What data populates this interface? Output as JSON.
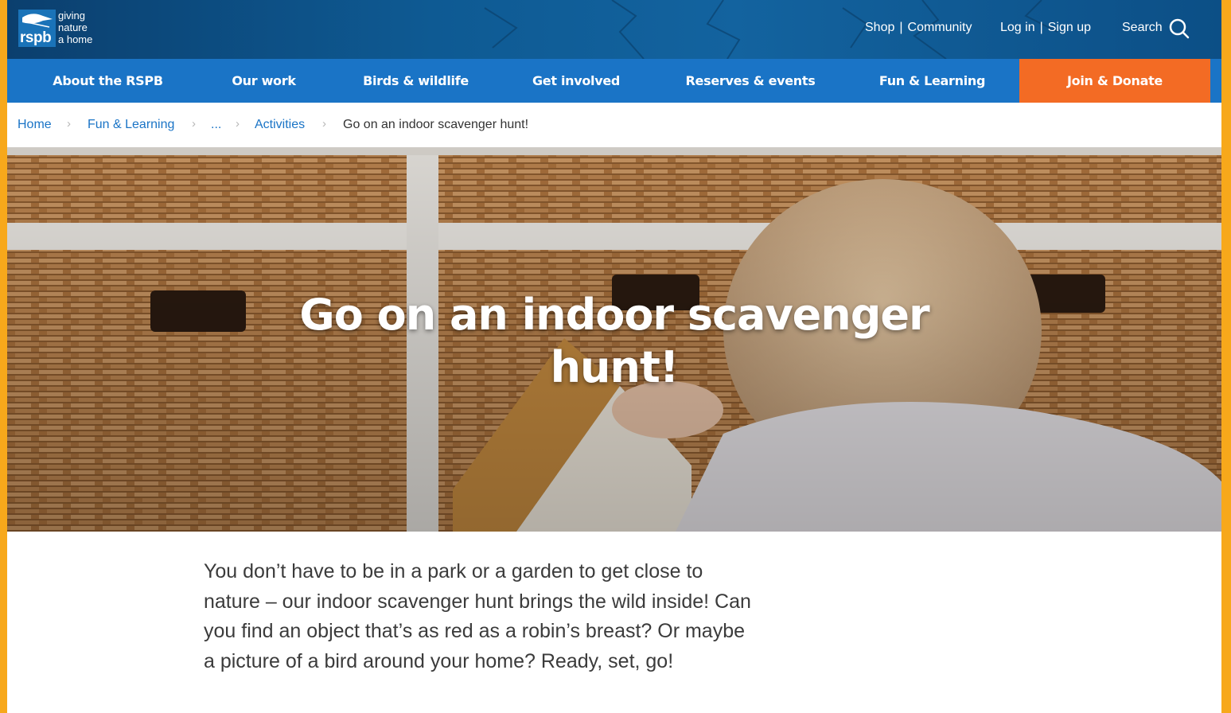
{
  "header": {
    "logo": {
      "brand": "rspb",
      "tagline": [
        "giving",
        "nature",
        "a home"
      ]
    },
    "utility": {
      "shop": "Shop",
      "community": "Community",
      "login": "Log in",
      "signup": "Sign up",
      "separator": "|",
      "search": "Search"
    }
  },
  "nav": {
    "items": [
      {
        "label": "About the RSPB"
      },
      {
        "label": "Our work"
      },
      {
        "label": "Birds & wildlife"
      },
      {
        "label": "Get involved"
      },
      {
        "label": "Reserves & events"
      },
      {
        "label": "Fun & Learning"
      }
    ],
    "donate": "Join & Donate",
    "colors": {
      "nav": "#1a74c6",
      "donate": "#f36b24",
      "link": "#1a74c6"
    }
  },
  "breadcrumb": {
    "items": [
      "Home",
      "Fun & Learning",
      "...",
      "Activities",
      "Go on an indoor scavenger hunt!"
    ]
  },
  "hero": {
    "title_line1": "Go on an indoor scavenger",
    "title_line2": "hunt!"
  },
  "intro": {
    "text": "You don’t have to be in a park or a garden to get close to nature – our indoor scavenger hunt brings the wild inside! Can you find an object that’s as red as a robin’s breast? Or maybe a picture of a bird around your home? Ready, set, go!"
  }
}
